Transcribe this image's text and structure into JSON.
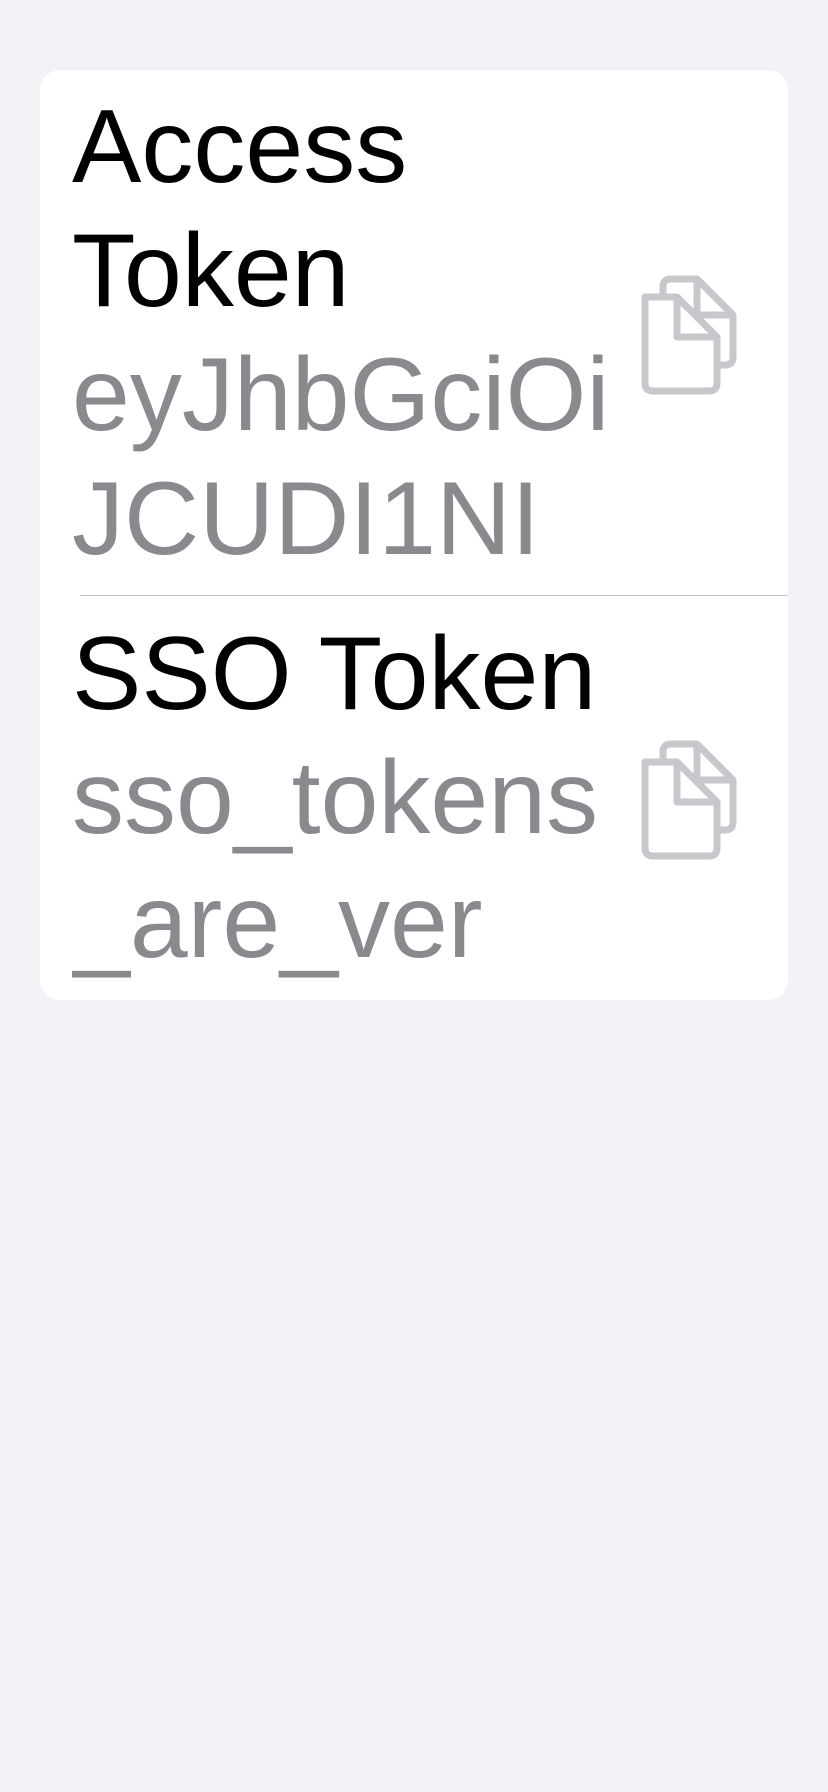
{
  "tokens": [
    {
      "title": "Access Token",
      "value": "eyJhbGciOiJCUDI1NIl...",
      "copy_icon": "doc-on-doc-icon"
    },
    {
      "title": "SSO Token",
      "value": "sso_tokens_are_very...",
      "copy_icon": "doc-on-doc-icon"
    }
  ],
  "colors": {
    "background": "#f2f2f7",
    "card": "#ffffff",
    "title": "#000000",
    "value": "#8a8a8e",
    "icon": "#c7c7cc",
    "divider": "#c6c6c8"
  }
}
